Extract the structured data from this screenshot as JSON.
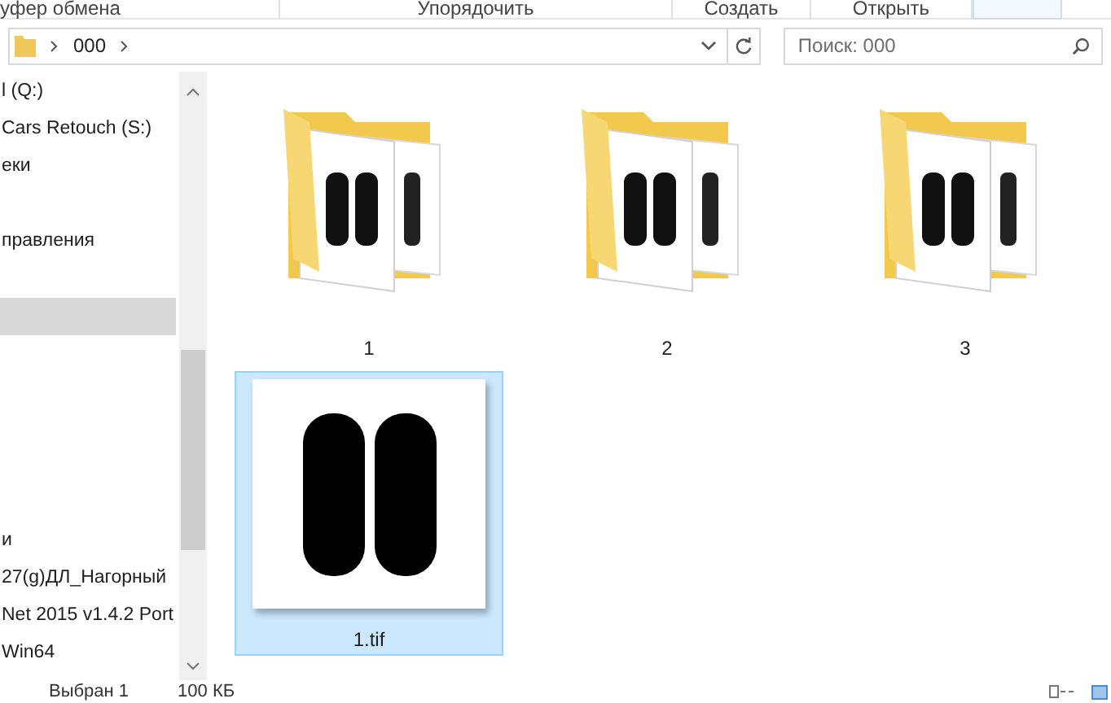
{
  "ribbon": {
    "groups": [
      "уфер обмена",
      "Упорядочить",
      "Создать",
      "Открыть"
    ]
  },
  "address_bar": {
    "path": [
      "000"
    ]
  },
  "search": {
    "placeholder": "Поиск: 000"
  },
  "nav_items": [
    {
      "label": "l (Q:)",
      "selected": false
    },
    {
      "label": "Cars Retouch (S:)",
      "selected": false
    },
    {
      "label": "еки",
      "selected": false
    },
    {
      "selected": false
    },
    {
      "label": "правления",
      "selected": false
    },
    {
      "selected": false
    },
    {
      "selected": true
    },
    {
      "selected": false
    },
    {
      "selected": false
    },
    {
      "selected": false
    },
    {
      "selected": false
    },
    {
      "selected": false
    },
    {
      "label": "и",
      "selected": false
    },
    {
      "label": "27(g)ДЛ_Нагорный",
      "selected": false
    },
    {
      "label": "Net 2015 v1.4.2 Port",
      "selected": false
    },
    {
      "label": "Win64",
      "selected": false
    }
  ],
  "items": [
    {
      "kind": "folder",
      "name": "1",
      "selected": false
    },
    {
      "kind": "folder",
      "name": "2",
      "selected": false
    },
    {
      "kind": "folder",
      "name": "3",
      "selected": false
    },
    {
      "kind": "image",
      "name": "1.tif",
      "selected": true
    }
  ],
  "status_bar": {
    "selection": "Выбран 1",
    "size": "100 КБ"
  }
}
